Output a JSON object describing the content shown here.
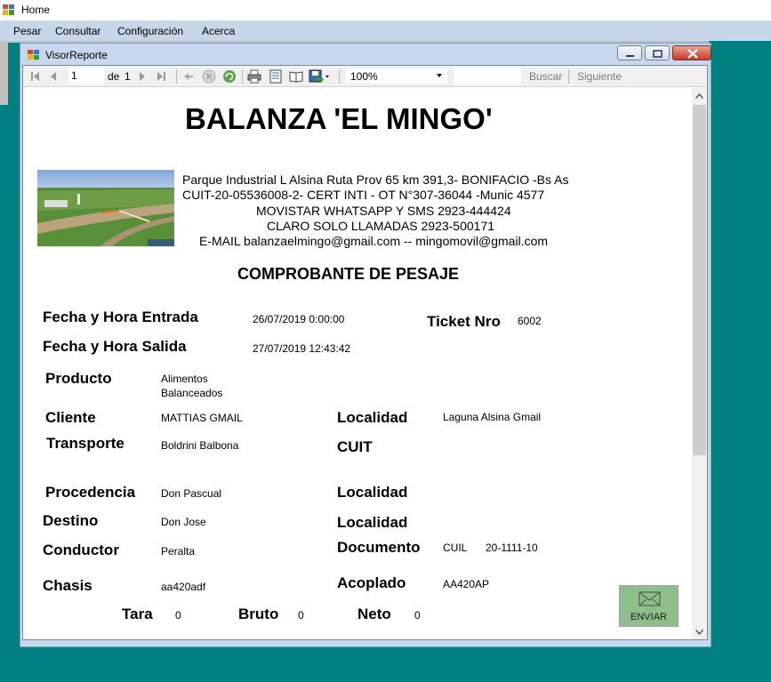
{
  "app": {
    "title": "Home"
  },
  "menu": [
    "Pesar",
    "Consultar",
    "Configuración",
    "Acerca"
  ],
  "child_window": {
    "title": "VisorReporte"
  },
  "toolbar": {
    "page_current": "1",
    "page_of_label": "de",
    "page_total": "1",
    "zoom": "100%",
    "search_placeholder": "",
    "search_label": "Buscar",
    "next_label": "Siguiente"
  },
  "report": {
    "company": "BALANZA 'EL MINGO'",
    "address_lines": [
      "Parque Industrial L Alsina Ruta Prov 65 km 391,3- BONIFACIO -Bs As",
      "CUIT-20-05536008-2- CERT INTI - OT N°307-36044 -Munic 4577",
      "MOVISTAR WHATSAPP Y SMS 2923-444424",
      "CLARO SOLO LLAMADAS 2923-500171",
      "E-MAIL balanzaelmingo@gmail.com -- mingomovil@gmail.com"
    ],
    "heading": "COMPROBANTE DE PESAJE",
    "fecha_entrada_label": "Fecha y Hora Entrada",
    "fecha_entrada": "26/07/2019 0:00:00",
    "ticket_label": "Ticket Nro",
    "ticket": "6002",
    "fecha_salida_label": "Fecha y Hora Salida",
    "fecha_salida": "27/07/2019 12:43:42",
    "producto_label": "Producto",
    "producto_line1": "Alimentos",
    "producto_line2": "Balanceados",
    "cliente_label": "Cliente",
    "cliente": "MATTIAS GMAIL",
    "localidad_label": "Localidad",
    "localidad_cliente": "Laguna Alsina Gmail",
    "transporte_label": "Transporte",
    "transporte": "Boldrini Balbona",
    "cuit_label": "CUIT",
    "procedencia_label": "Procedencia",
    "procedencia": "Don Pascual",
    "destino_label": "Destino",
    "destino": "Don Jose",
    "conductor_label": "Conductor",
    "conductor": "Peralta",
    "documento_label": "Documento",
    "documento_tipo": "CUIL",
    "documento_numero": "20-1111-10",
    "chasis_label": "Chasis",
    "chasis": "aa420adf",
    "acoplado_label": "Acoplado",
    "acoplado": "AA420AP",
    "tara_label": "Tara",
    "tara": "0",
    "bruto_label": "Bruto",
    "bruto": "0",
    "neto_label": "Neto",
    "neto": "0"
  },
  "send_button": {
    "label": "ENVIAR"
  }
}
